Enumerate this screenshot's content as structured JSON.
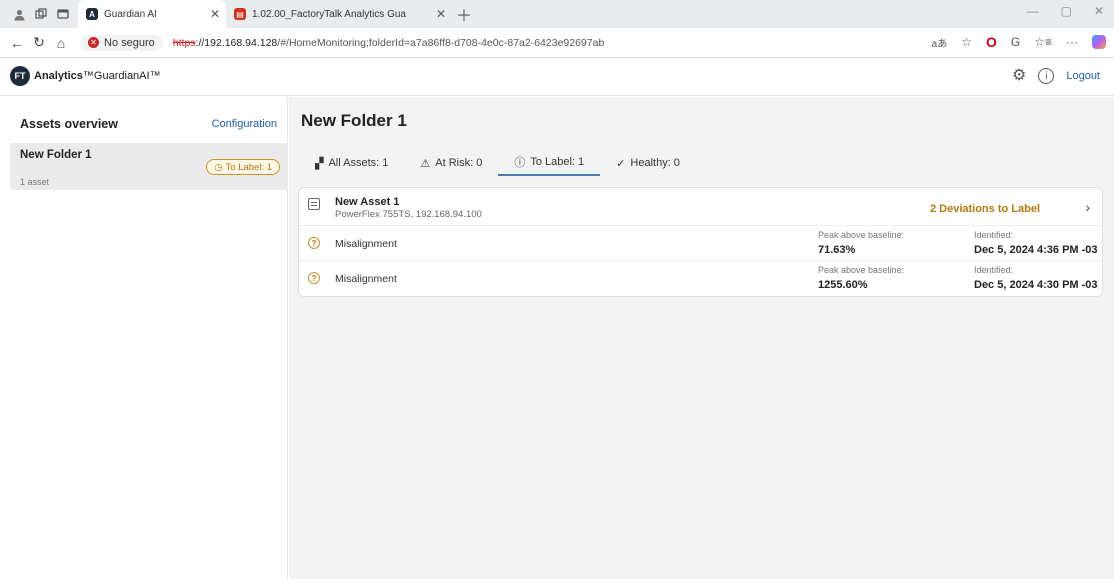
{
  "browser": {
    "tabs": [
      {
        "title": "Guardian AI"
      },
      {
        "title": "1.02.00_FactoryTalk Analytics Gua"
      }
    ],
    "security_label": "No seguro",
    "url_scheme": "https",
    "url_host": "://192.168.94.128",
    "url_path": "/#/HomeMonitoring;folderId=a7a86ff8-d708-4e0c-87a2-6423e92697ab"
  },
  "app": {
    "logo_mark": "FT",
    "brand_bold": "Analytics",
    "brand_rest": "GuardianAI",
    "logout_label": "Logout"
  },
  "sidebar": {
    "title": "Assets overview",
    "config_label": "Configuration",
    "folder": {
      "name": "New Folder 1",
      "count": "1 asset",
      "badge": "To Label: 1"
    }
  },
  "main": {
    "title": "New Folder 1",
    "tabs": [
      {
        "label": "All Assets: 1"
      },
      {
        "label": "At Risk: 0"
      },
      {
        "label": "To Label: 1"
      },
      {
        "label": "Healthy: 0"
      }
    ],
    "active_tab_index": 2,
    "asset": {
      "name": "New Asset 1",
      "sub": "PowerFlex 755TS, 192.168.94.100",
      "deviations": "2 Deviations to Label"
    },
    "rows": [
      {
        "label": "Misalignment",
        "peak_key": "Peak above baseline:",
        "peak": "71.63%",
        "ident_key": "Identified:",
        "ident": "Dec 5, 2024 4:36 PM -03"
      },
      {
        "label": "Misalignment",
        "peak_key": "Peak above baseline:",
        "peak": "1255.60%",
        "ident_key": "Identified:",
        "ident": "Dec 5, 2024 4:30 PM -03"
      }
    ]
  },
  "colors": {
    "accent": "#1d5fa8",
    "warning": "#b07a12",
    "tab_underline": "#4a79b0"
  }
}
